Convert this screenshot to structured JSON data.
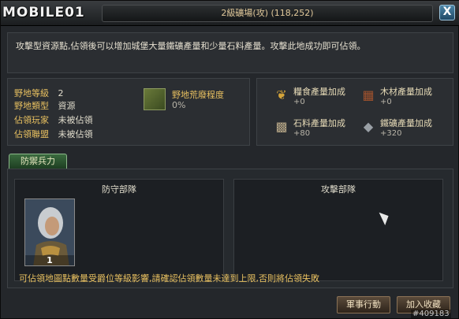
{
  "window": {
    "logo_text": "MOBILE01",
    "title": "2級礦場(攻) (118,252)",
    "close_label": "X"
  },
  "description": "攻擊型資源點,佔領後可以增加城堡大量鐵礦產量和少量石料產量。攻擊此地成功即可佔領。",
  "info": {
    "rows": [
      {
        "label": "野地等級",
        "value": "2"
      },
      {
        "label": "野地類型",
        "value": "資源"
      },
      {
        "label": "佔領玩家",
        "value": "未被佔領"
      },
      {
        "label": "佔領聯盟",
        "value": "未被佔領"
      }
    ],
    "barren_label": "野地荒廢程度",
    "barren_value": "0%",
    "barren_icon": "field-ruin-icon"
  },
  "production": [
    {
      "name": "糧食產量加成",
      "value": "+0",
      "icon": "wheat-icon",
      "color": "#d4a43a"
    },
    {
      "name": "木材產量加成",
      "value": "+0",
      "icon": "wood-icon",
      "color": "#a0522d"
    },
    {
      "name": "石料產量加成",
      "value": "+80",
      "icon": "stone-icon",
      "color": "#b8a888"
    },
    {
      "name": "鐵礦產量加成",
      "value": "+320",
      "icon": "iron-ore-icon",
      "color": "#9aa0a6"
    }
  ],
  "tab_label": "防禦兵力",
  "defense": {
    "header": "防守部隊",
    "hero_count": "1"
  },
  "attack": {
    "header": "攻擊部隊"
  },
  "notice": "可佔領地圖點數量受爵位等級影響,請確認佔領數量未達到上限,否則將佔領失敗",
  "buttons": {
    "military": "軍事行動",
    "favorite": "加入收藏"
  },
  "watermark": "#409183"
}
